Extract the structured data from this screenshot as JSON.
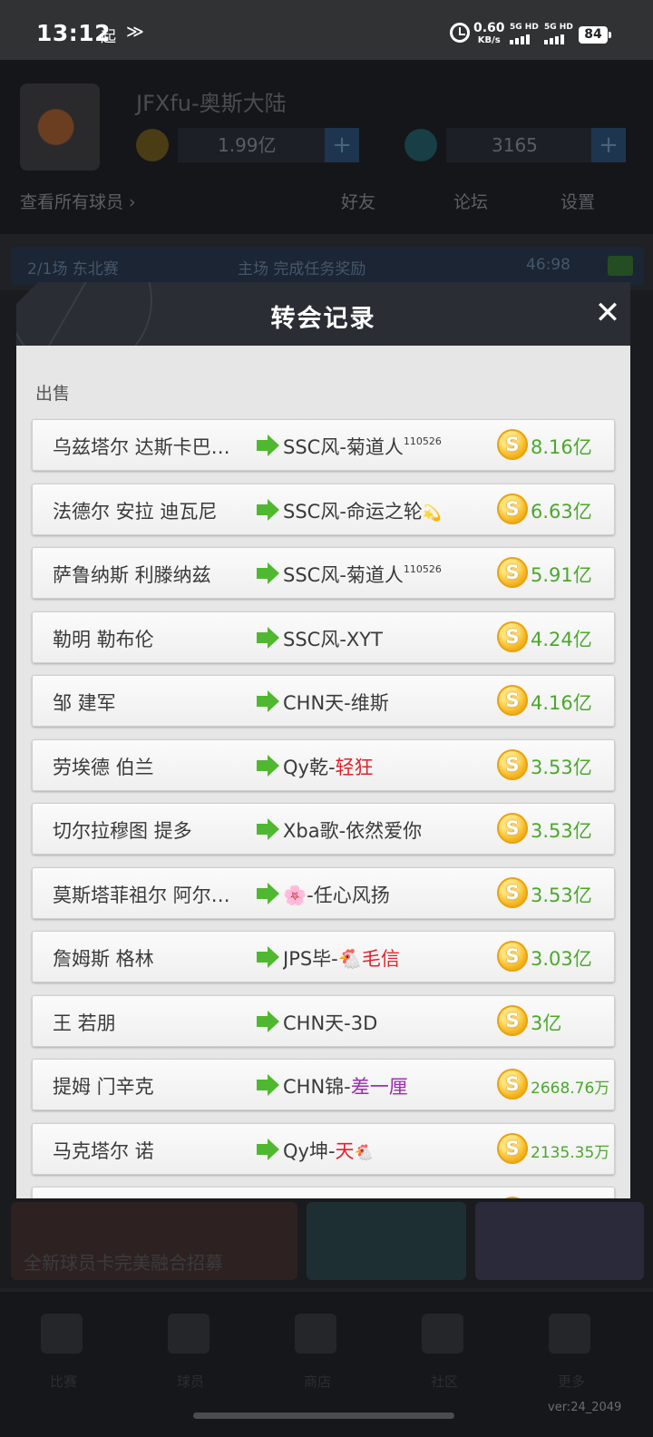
{
  "status_bar": {
    "time": "13:12",
    "icon_a": "起",
    "icon_b": "≫",
    "net_speed": "0.60",
    "net_unit": "KB/s",
    "sim1": "5G HD",
    "sim2": "5G HD",
    "battery": "84"
  },
  "modal": {
    "title": "转会记录",
    "close": "✕",
    "section_label": "出售",
    "rows": [
      {
        "player": "乌兹塔尔 达斯卡巴…",
        "club_prefix": "SSC风-菊道人",
        "club_colored": "",
        "club_color": "",
        "club_emoji": "",
        "club_sup": "110526",
        "price": "8.16亿",
        "price_small": false
      },
      {
        "player": "法德尔 安拉 迪瓦尼",
        "club_prefix": "SSC风-命运之轮",
        "club_colored": "",
        "club_color": "",
        "club_emoji": "💫",
        "club_sup": "",
        "price": "6.63亿",
        "price_small": false
      },
      {
        "player": "萨鲁纳斯 利滕纳兹",
        "club_prefix": "SSC风-菊道人",
        "club_colored": "",
        "club_color": "",
        "club_emoji": "",
        "club_sup": "110526",
        "price": "5.91亿",
        "price_small": false
      },
      {
        "player": "勒明 勒布伦",
        "club_prefix": "SSC风-XYT",
        "club_colored": "",
        "club_color": "",
        "club_emoji": "",
        "club_sup": "",
        "price": "4.24亿",
        "price_small": false
      },
      {
        "player": "邹 建军",
        "club_prefix": "CHN天-维斯",
        "club_colored": "",
        "club_color": "",
        "club_emoji": "",
        "club_sup": "",
        "price": "4.16亿",
        "price_small": false
      },
      {
        "player": "劳埃德 伯兰",
        "club_prefix": "Qy乾-",
        "club_colored": "轻狂",
        "club_color": "#e0232b",
        "club_emoji": "",
        "club_sup": "",
        "price": "3.53亿",
        "price_small": false
      },
      {
        "player": "切尔拉穆图 提多",
        "club_prefix": "Xba歌-依然爱你",
        "club_colored": "",
        "club_color": "",
        "club_emoji": "",
        "club_sup": "",
        "price": "3.53亿",
        "price_small": false
      },
      {
        "player": "莫斯塔菲祖尔 阿尔…",
        "club_prefix": "🌸-任心风扬",
        "club_colored": "",
        "club_color": "",
        "club_emoji": "",
        "club_sup": "",
        "price": "3.53亿",
        "price_small": false
      },
      {
        "player": "詹姆斯 格林",
        "club_prefix": "JPS毕-🐔",
        "club_colored": "毛信",
        "club_color": "#e0232b",
        "club_emoji": "",
        "club_sup": "",
        "price": "3.03亿",
        "price_small": false
      },
      {
        "player": "王 若朋",
        "club_prefix": "CHN天-3D",
        "club_colored": "",
        "club_color": "",
        "club_emoji": "",
        "club_sup": "",
        "price": "3亿",
        "price_small": false
      },
      {
        "player": "提姆 门辛克",
        "club_prefix": "CHN锦-",
        "club_colored": "差一厘",
        "club_color": "#9b2fae",
        "club_emoji": "",
        "club_sup": "",
        "price": "2668.76万",
        "price_small": true
      },
      {
        "player": "马克塔尔 诺",
        "club_prefix": "Qy坤-",
        "club_colored": "天",
        "club_color": "#e0232b",
        "club_emoji": "🐔",
        "club_sup": "",
        "price": "2135.35万",
        "price_small": true
      }
    ]
  },
  "background": {
    "app_name": "JFXfu-奥斯大陆",
    "gold": "1.99亿",
    "diamond": "3165",
    "link_left": "查看所有球员 ›",
    "link_mid": "好友",
    "link_right1": "论坛",
    "link_right2": "设置",
    "strip_text1": "2/1场  东北赛",
    "strip_text2": "主场  完成任务奖励",
    "strip_text3": "46:98",
    "card_text": "全新球员卡完美融合招募",
    "tab_labels": [
      "比赛",
      "球员",
      "商店",
      "社区",
      "更多"
    ],
    "version": "ver:24_2049"
  }
}
